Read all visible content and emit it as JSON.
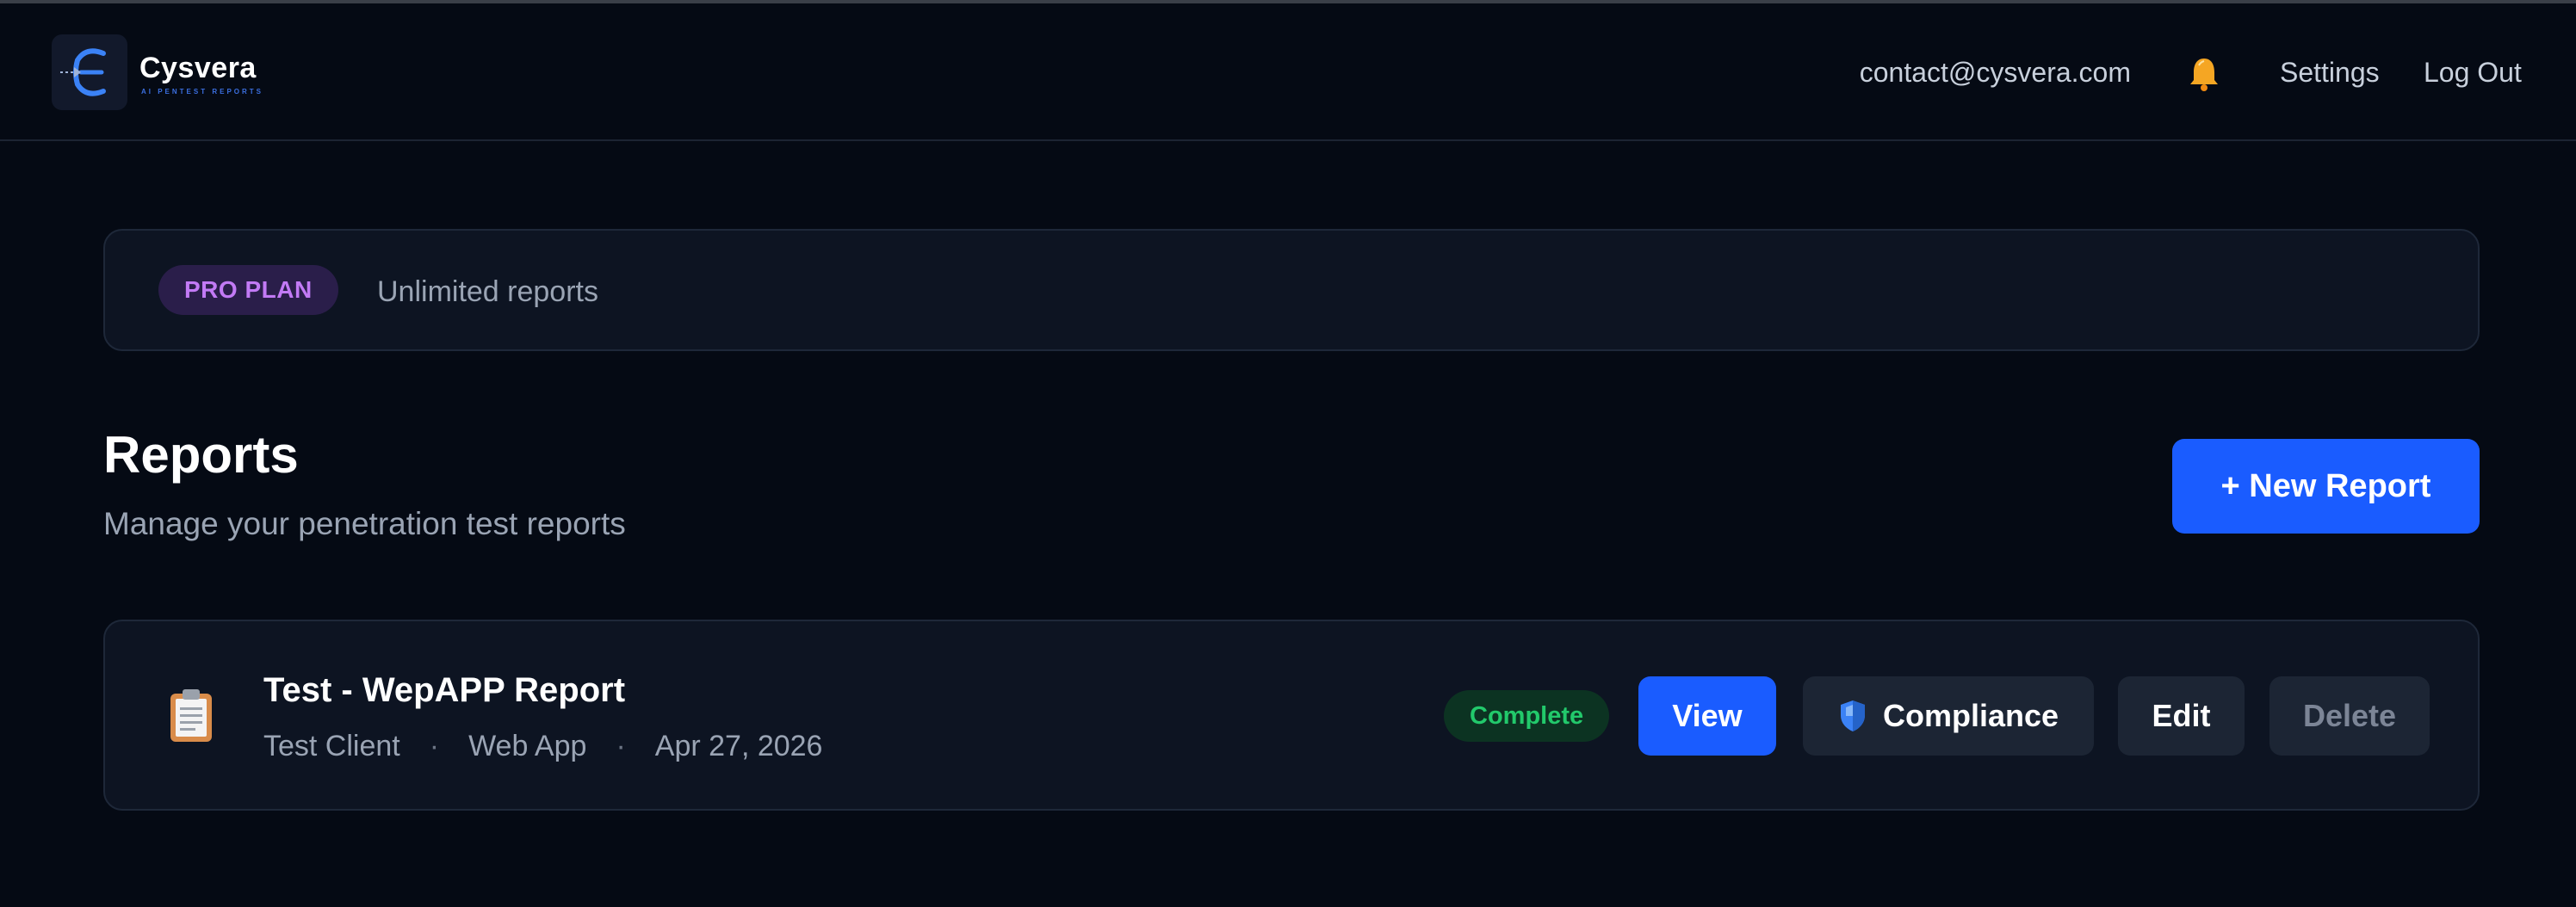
{
  "header": {
    "brand_name": "Cysvera",
    "brand_tagline": "AI PENTEST REPORTS",
    "email": "contact@cysvera.com",
    "bell_icon": "bell-icon",
    "settings_label": "Settings",
    "logout_label": "Log Out"
  },
  "plan": {
    "badge": "PRO PLAN",
    "text": "Unlimited reports"
  },
  "reports_section": {
    "title": "Reports",
    "subtitle": "Manage your penetration test reports",
    "new_report_label": "+ New Report"
  },
  "reports": [
    {
      "icon": "clipboard-icon",
      "title": "Test - WepAPP Report",
      "client": "Test Client",
      "type": "Web App",
      "date": "Apr 27, 2026",
      "separator": "·",
      "status": "Complete",
      "actions": {
        "view": "View",
        "compliance": "Compliance",
        "compliance_icon": "shield-icon",
        "edit": "Edit",
        "delete": "Delete"
      }
    }
  ],
  "colors": {
    "background": "#050a14",
    "accent": "#1a5cff",
    "plan_badge": "#c27af5",
    "status_complete": "#22c96b"
  }
}
